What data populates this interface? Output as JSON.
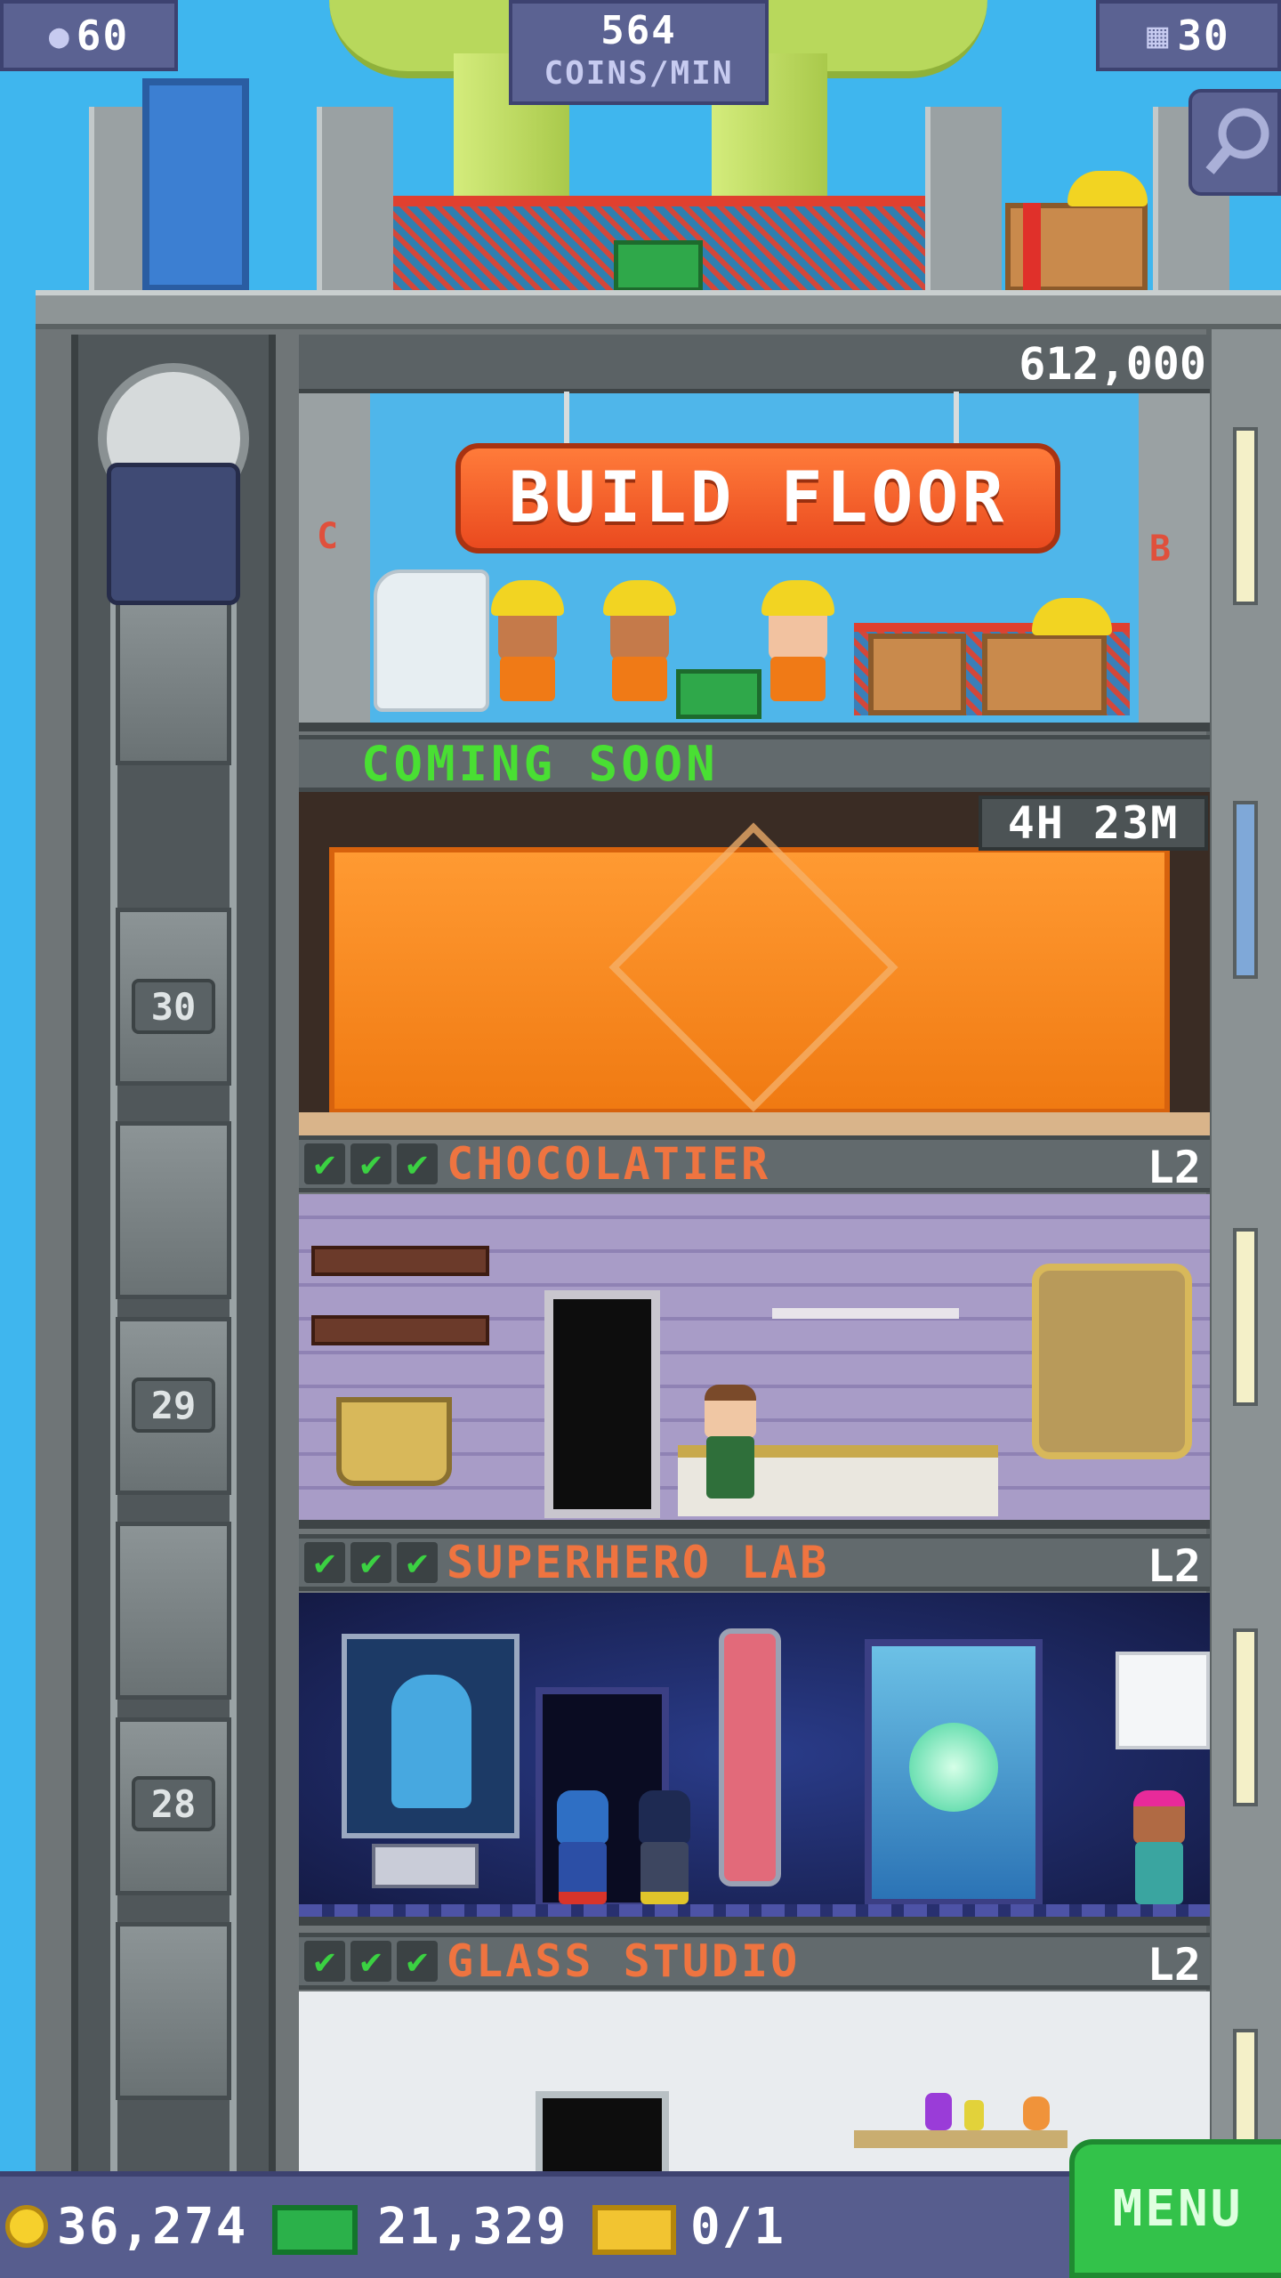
{
  "hud": {
    "population": "60",
    "coins_per_min_value": "564",
    "coins_per_min_label": "COINS/MIN",
    "floors": "30",
    "population_icon": "person-icon",
    "floors_icon": "building-icon",
    "search_icon": "magnifier-icon"
  },
  "build": {
    "price": "612,000",
    "button_label": "BUILD FLOOR",
    "left_sign": "C",
    "right_sign": "B"
  },
  "construction": {
    "status_label": "COMING SOON",
    "timer": "4H 23M",
    "sign_icon": "construction-worker-icon"
  },
  "elevator": {
    "floor_numbers": [
      "30",
      "29",
      "28"
    ]
  },
  "floors": [
    {
      "name": "CHOCOLATIER",
      "level": "L2",
      "checks": 3
    },
    {
      "name": "SUPERHERO LAB",
      "level": "L2",
      "checks": 3
    },
    {
      "name": "GLASS STUDIO",
      "level": "L2",
      "checks": 3
    }
  ],
  "bottom": {
    "coins": "36,274",
    "bux": "21,329",
    "tickets": "0/1",
    "menu_label": "MENU"
  },
  "colors": {
    "sky": "#3fb6ee",
    "build_button": "#ef5a26",
    "coming_soon": "#49df33",
    "floor_title": "#ef7440",
    "check": "#3bd142",
    "menu": "#33c24a",
    "hud": "#5b6292"
  }
}
